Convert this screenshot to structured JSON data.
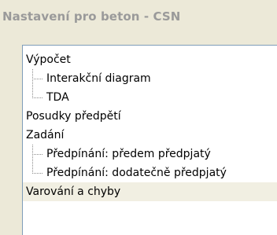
{
  "window": {
    "title": "Nastavení pro beton - CSN"
  },
  "tree": {
    "items": [
      {
        "label": "Výpočet"
      },
      {
        "label": "Interakční diagram"
      },
      {
        "label": "TDA"
      },
      {
        "label": "Posudky předpětí"
      },
      {
        "label": "Zadání"
      },
      {
        "label": "Předpínání: předem předpjatý"
      },
      {
        "label": "Předpínání: dodatečně předpjatý"
      },
      {
        "label": "Varování a chyby",
        "selected": true
      }
    ]
  }
}
